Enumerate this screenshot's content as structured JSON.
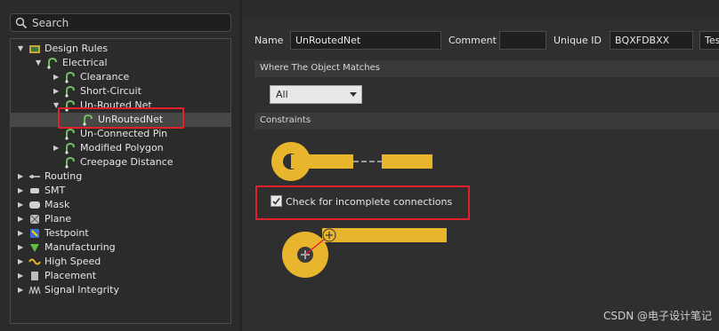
{
  "search": {
    "placeholder": "Search"
  },
  "tree": [
    {
      "label": "Design Rules",
      "icon": "design-rules-icon",
      "expander": "▼"
    },
    {
      "label": "Electrical",
      "icon": "rule-icon",
      "expander": "▼"
    },
    {
      "label": "Clearance",
      "icon": "rule-icon",
      "expander": "▶"
    },
    {
      "label": "Short-Circuit",
      "icon": "rule-icon",
      "expander": "▶"
    },
    {
      "label": "Un-Routed Net",
      "icon": "rule-icon",
      "expander": "▼"
    },
    {
      "label": "UnRoutedNet",
      "icon": "rule-icon",
      "expander": ""
    },
    {
      "label": "Un-Connected Pin",
      "icon": "rule-icon",
      "expander": ""
    },
    {
      "label": "Modified Polygon",
      "icon": "rule-icon",
      "expander": "▶"
    },
    {
      "label": "Creepage Distance",
      "icon": "rule-icon",
      "expander": ""
    },
    {
      "label": "Routing",
      "icon": "routing-icon",
      "expander": "▶"
    },
    {
      "label": "SMT",
      "icon": "smt-icon",
      "expander": "▶"
    },
    {
      "label": "Mask",
      "icon": "mask-icon",
      "expander": "▶"
    },
    {
      "label": "Plane",
      "icon": "plane-icon",
      "expander": "▶"
    },
    {
      "label": "Testpoint",
      "icon": "testpoint-icon",
      "expander": "▶"
    },
    {
      "label": "Manufacturing",
      "icon": "manufacturing-icon",
      "expander": "▶"
    },
    {
      "label": "High Speed",
      "icon": "high-speed-icon",
      "expander": "▶"
    },
    {
      "label": "Placement",
      "icon": "placement-icon",
      "expander": "▶"
    },
    {
      "label": "Signal Integrity",
      "icon": "signal-integrity-icon",
      "expander": "▶"
    }
  ],
  "rule": {
    "name_label": "Name",
    "name_value": "UnRoutedNet",
    "comment_label": "Comment",
    "comment_value": "",
    "uid_label": "Unique ID",
    "uid_value": "BQXFDBXX",
    "test_button": "Tes"
  },
  "where_header": "Where The Object Matches",
  "match_value": "All",
  "constraints_header": "Constraints",
  "check_label": "Check for incomplete connections",
  "check_checked": true,
  "watermark": "CSDN @电子设计笔记",
  "colors": {
    "pad": "#e8b52c",
    "highlight": "#e0202a",
    "background": "#2b2b2b"
  }
}
